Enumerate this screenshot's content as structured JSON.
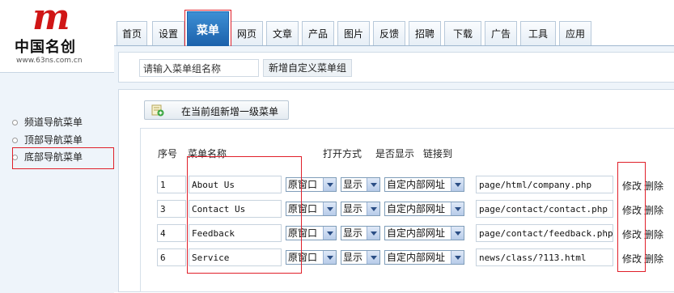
{
  "brand": {
    "logo_letter": "m",
    "name": "中国名创",
    "url": "www.63ns.com.cn"
  },
  "nav": {
    "tabs": [
      "首页",
      "设置",
      "菜单",
      "网页",
      "文章",
      "产品",
      "图片",
      "反馈",
      "招聘",
      "下载",
      "广告",
      "工具",
      "应用"
    ],
    "active": "菜单"
  },
  "sidebar": {
    "items": [
      "频道导航菜单",
      "顶部导航菜单",
      "底部导航菜单"
    ],
    "selected": "底部导航菜单"
  },
  "group": {
    "input_value": "请输入菜单组名称",
    "add_button": "新增自定义菜单组"
  },
  "panel": {
    "add_top_button": "在当前组新增一级菜单",
    "headers": {
      "seq": "序号",
      "name": "菜单名称",
      "open": "打开方式",
      "show": "是否显示",
      "link": "链接到"
    },
    "rows": [
      {
        "seq": "1",
        "name": "About Us",
        "open": "原窗口",
        "show": "显示",
        "type": "自定内部网址",
        "url": "page/html/company.php",
        "edit": "修改",
        "del": "删除"
      },
      {
        "seq": "3",
        "name": "Contact Us",
        "open": "原窗口",
        "show": "显示",
        "type": "自定内部网址",
        "url": "page/contact/contact.php",
        "edit": "修改",
        "del": "删除"
      },
      {
        "seq": "4",
        "name": "Feedback",
        "open": "原窗口",
        "show": "显示",
        "type": "自定内部网址",
        "url": "page/contact/feedback.php",
        "edit": "修改",
        "del": "删除"
      },
      {
        "seq": "6",
        "name": "Service",
        "open": "原窗口",
        "show": "显示",
        "type": "自定内部网址",
        "url": "news/class/?113.html",
        "edit": "修改",
        "del": "删除"
      }
    ]
  },
  "colors": {
    "highlight": "#e0202a",
    "active_tab": "#1c62ac",
    "sidebar_bg": "#eef4fa"
  }
}
